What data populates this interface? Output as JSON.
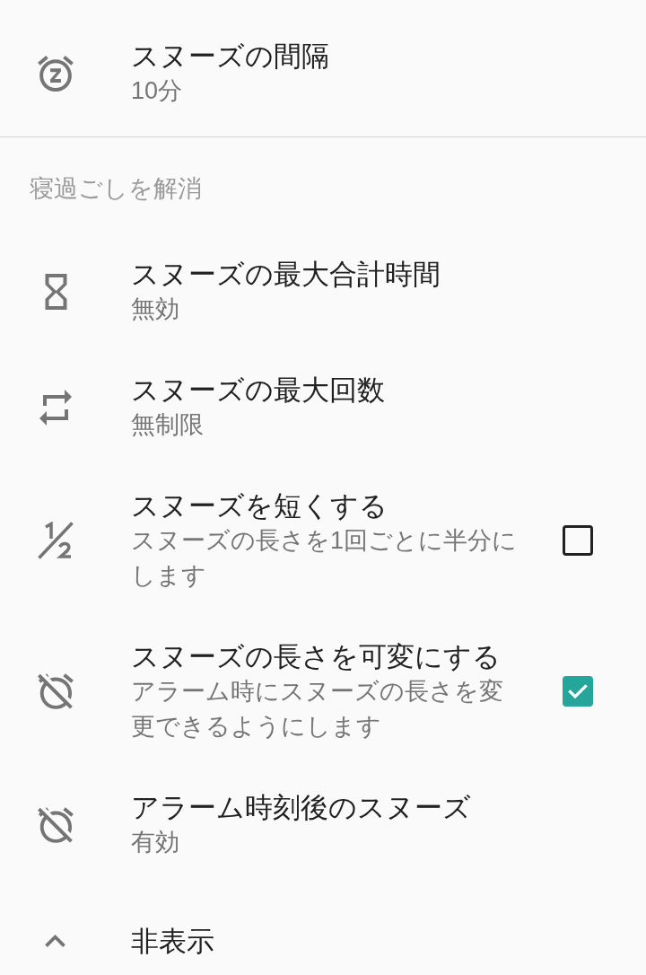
{
  "top_items": [
    {
      "kind": "preference",
      "title": "スヌーズの間隔",
      "summary": "10分"
    }
  ],
  "section": {
    "header": "寝過ごしを解消",
    "items": [
      {
        "kind": "preference",
        "title": "スヌーズの最大合計時間",
        "summary": "無効"
      },
      {
        "kind": "preference",
        "title": "スヌーズの最大回数",
        "summary": "無制限"
      },
      {
        "kind": "checkbox",
        "title": "スヌーズを短くする",
        "summary": "スヌーズの長さを1回ごとに半分にします",
        "checked": false
      },
      {
        "kind": "checkbox",
        "title": "スヌーズの長さを可変にする",
        "summary": "アラーム時にスヌーズの長さを変更できるようにします",
        "checked": true
      },
      {
        "kind": "preference",
        "title": "アラーム時刻後のスヌーズ",
        "summary": "有効"
      }
    ]
  },
  "collapse_button": {
    "label": "非表示"
  }
}
